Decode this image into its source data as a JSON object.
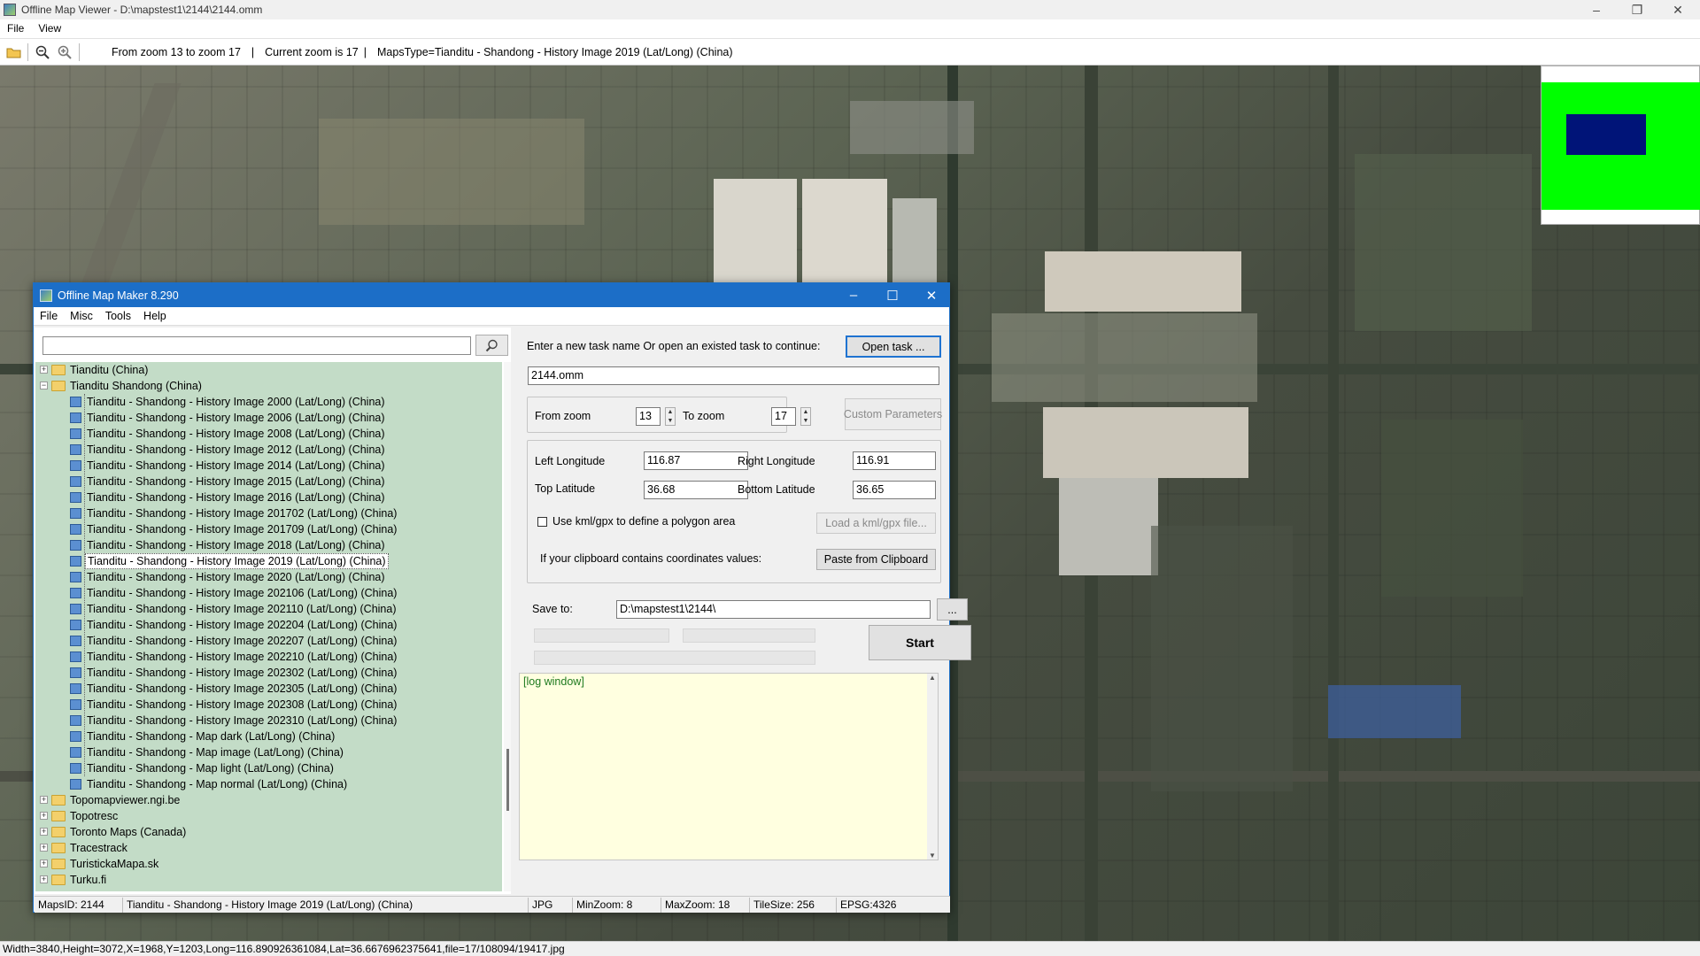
{
  "viewer": {
    "title": "Offline Map Viewer - D:\\mapstest1\\2144\\2144.omm",
    "menu": [
      "File",
      "View"
    ],
    "toolbar": {
      "zoom_range": "From zoom 13 to zoom 17",
      "separator": "|",
      "current_zoom": "Current zoom is 17",
      "maps_type": "MapsType=Tianditu - Shandong - History Image 2019 (Lat/Long) (China)"
    },
    "status": "Width=3840,Height=3072,X=1968,Y=1203,Long=116.890926361084,Lat=36.6676962375641,file=17/108094/19417.jpg"
  },
  "dialog": {
    "title": "Offline Map Maker 8.290",
    "menu": [
      "File",
      "Misc",
      "Tools",
      "Help"
    ],
    "search": {
      "value": "",
      "placeholder": ""
    },
    "tree": {
      "top_groups": [
        {
          "label": "Tianditu (China)",
          "expanded": false
        },
        {
          "label": "Tianditu Shandong (China)",
          "expanded": true
        }
      ],
      "children": [
        "Tianditu - Shandong - History Image 2000 (Lat/Long) (China)",
        "Tianditu - Shandong - History Image 2006 (Lat/Long) (China)",
        "Tianditu - Shandong - History Image 2008 (Lat/Long) (China)",
        "Tianditu - Shandong - History Image 2012 (Lat/Long) (China)",
        "Tianditu - Shandong - History Image 2014 (Lat/Long) (China)",
        "Tianditu - Shandong - History Image 2015 (Lat/Long) (China)",
        "Tianditu - Shandong - History Image 2016 (Lat/Long) (China)",
        "Tianditu - Shandong - History Image 201702 (Lat/Long) (China)",
        "Tianditu - Shandong - History Image 201709 (Lat/Long) (China)",
        "Tianditu - Shandong - History Image 2018 (Lat/Long) (China)",
        "Tianditu - Shandong - History Image 2019 (Lat/Long) (China)",
        "Tianditu - Shandong - History Image 2020 (Lat/Long) (China)",
        "Tianditu - Shandong - History Image 202106 (Lat/Long) (China)",
        "Tianditu - Shandong - History Image 202110 (Lat/Long) (China)",
        "Tianditu - Shandong - History Image 202204 (Lat/Long) (China)",
        "Tianditu - Shandong - History Image 202207 (Lat/Long) (China)",
        "Tianditu - Shandong - History Image 202210 (Lat/Long) (China)",
        "Tianditu - Shandong - History Image 202302 (Lat/Long) (China)",
        "Tianditu - Shandong - History Image 202305 (Lat/Long) (China)",
        "Tianditu - Shandong - History Image 202308 (Lat/Long) (China)",
        "Tianditu - Shandong - History Image 202310 (Lat/Long) (China)",
        "Tianditu - Shandong - Map dark (Lat/Long) (China)",
        "Tianditu - Shandong - Map image (Lat/Long) (China)",
        "Tianditu - Shandong - Map light (Lat/Long) (China)",
        "Tianditu - Shandong - Map normal (Lat/Long) (China)"
      ],
      "selected_child": "Tianditu - Shandong - History Image 2019 (Lat/Long) (China)",
      "bottom_groups": [
        "Topomapviewer.ngi.be",
        "Topotresc",
        "Toronto Maps (Canada)",
        "Tracestrack",
        "TuristickaMapa.sk",
        "Turku.fi"
      ]
    },
    "form": {
      "task_prompt": "Enter a new task name Or open an existed task to continue:",
      "open_task_button": "Open task ...",
      "task_name": "2144.omm",
      "from_zoom_label": "From zoom",
      "from_zoom": "13",
      "to_zoom_label": "To zoom",
      "to_zoom": "17",
      "custom_params_button": "Custom Parameters",
      "left_lon_label": "Left Longitude",
      "left_lon": "116.87",
      "right_lon_label": "Right Longitude",
      "right_lon": "116.91",
      "top_lat_label": "Top Latitude",
      "top_lat": "36.68",
      "bottom_lat_label": "Bottom Latitude",
      "bottom_lat": "36.65",
      "kml_checkbox_label": "Use kml/gpx to define a polygon area",
      "load_kml_button": "Load a kml/gpx file...",
      "clipboard_prompt": "If your clipboard contains coordinates values:",
      "paste_button": "Paste from Clipboard",
      "save_to_label": "Save to:",
      "save_to": "D:\\mapstest1\\2144\\",
      "browse_button": "...",
      "start_button": "Start",
      "log_text": "[log window]"
    },
    "status": {
      "maps_id": "MapsID: 2144",
      "map_name": "Tianditu - Shandong - History Image 2019 (Lat/Long) (China)",
      "format": "JPG",
      "min_zoom": "MinZoom: 8",
      "max_zoom": "MaxZoom: 18",
      "tile_size": "TileSize: 256",
      "epsg": "EPSG:4326"
    }
  },
  "colors": {
    "dialog_title_bar": "#1c6ec7",
    "tree_background": "#c3dcc7",
    "log_background": "#ffffe0",
    "minimap_bounds": "#00ff00",
    "minimap_viewport": "#001478"
  }
}
